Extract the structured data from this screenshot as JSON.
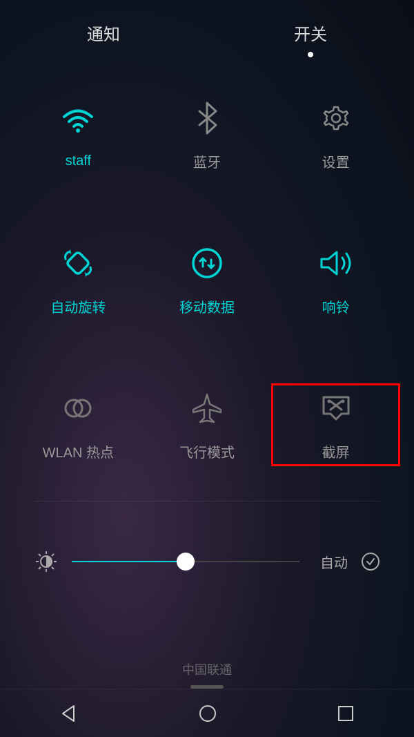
{
  "colors": {
    "accent": "#00d4d4",
    "inactive": "#999999",
    "highlight": "#ff0000"
  },
  "tabs": {
    "notifications": "通知",
    "toggles": "开关",
    "active": "toggles"
  },
  "tiles": [
    {
      "id": "wifi",
      "label": "staff",
      "on": true,
      "icon": "wifi-icon"
    },
    {
      "id": "bluetooth",
      "label": "蓝牙",
      "on": false,
      "icon": "bluetooth-icon"
    },
    {
      "id": "settings",
      "label": "设置",
      "on": false,
      "icon": "gear-icon"
    },
    {
      "id": "rotate",
      "label": "自动旋转",
      "on": true,
      "icon": "rotate-icon"
    },
    {
      "id": "data",
      "label": "移动数据",
      "on": true,
      "icon": "data-icon"
    },
    {
      "id": "sound",
      "label": "响铃",
      "on": true,
      "icon": "sound-icon"
    },
    {
      "id": "hotspot",
      "label": "WLAN 热点",
      "on": false,
      "icon": "hotspot-icon"
    },
    {
      "id": "airplane",
      "label": "飞行模式",
      "on": false,
      "icon": "airplane-icon"
    },
    {
      "id": "screenshot",
      "label": "截屏",
      "on": false,
      "icon": "screenshot-icon",
      "highlighted": true
    }
  ],
  "brightness": {
    "value_percent": 50,
    "auto_label": "自动",
    "auto_enabled": true
  },
  "carrier": "中国联通"
}
